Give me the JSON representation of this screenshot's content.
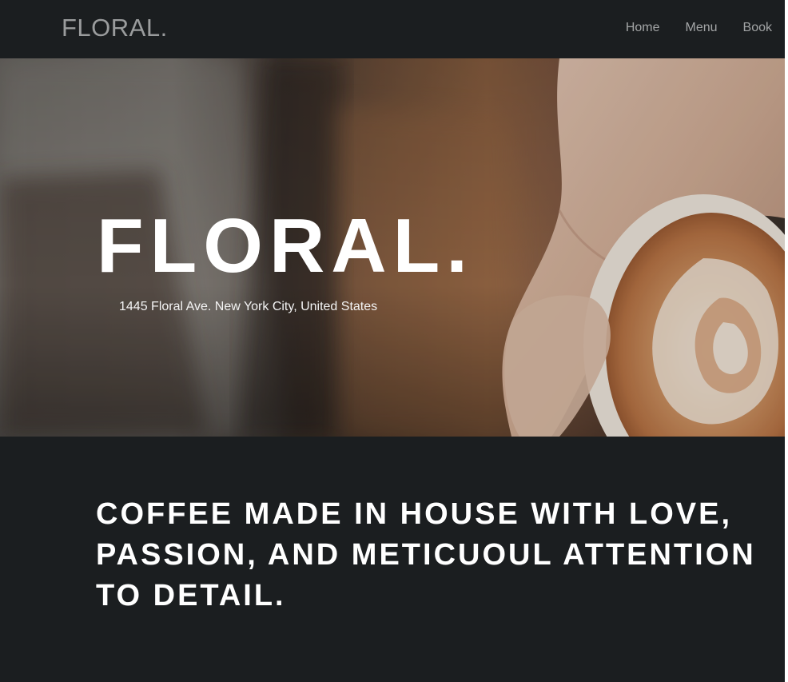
{
  "navbar": {
    "brand": "FLORAL.",
    "links": [
      {
        "label": "Home"
      },
      {
        "label": "Menu"
      },
      {
        "label": "Book"
      }
    ]
  },
  "hero": {
    "title": "FLORAL.",
    "address": "1445 Floral Ave. New York City, United States"
  },
  "tagline": {
    "text": "COFFEE MADE IN HOUSE WITH LOVE, PASSION, AND METICUOUL ATTENTION TO DETAIL."
  },
  "colors": {
    "background": "#1b1e20",
    "nav_text": "#a3a5a6",
    "brand_text": "#9a9c9d",
    "hero_text": "#ffffff",
    "foam": "#c98a5a"
  },
  "icons": {
    "hero_image": "latte-art-cup-photo"
  }
}
